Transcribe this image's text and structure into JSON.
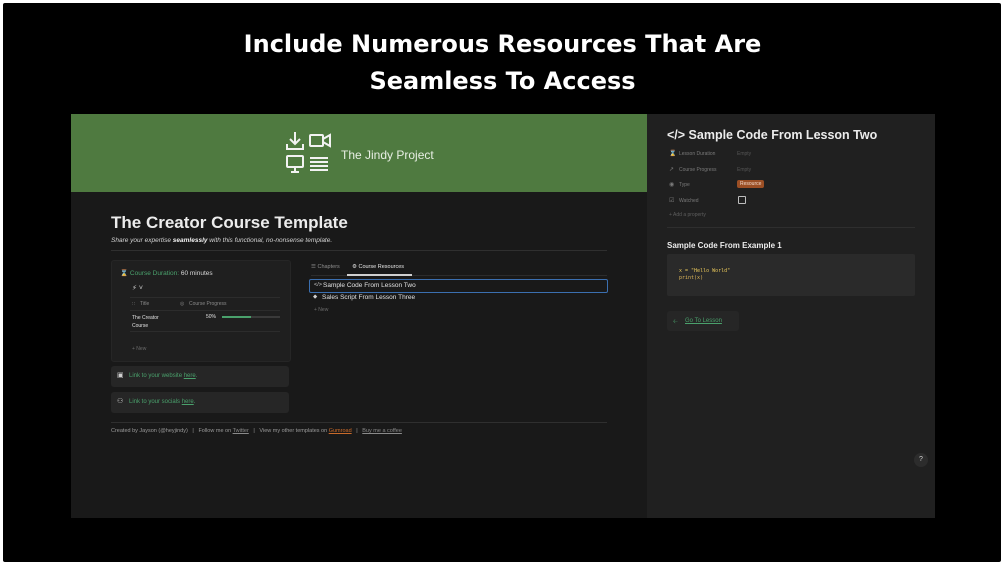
{
  "headline": {
    "line1": "Include Numerous Resources That Are",
    "line2": "Seamless To Access"
  },
  "page": {
    "cover_title": "The Jindy Project",
    "title": "The Creator Course Template",
    "subtitle_pre": "Share your expertise ",
    "subtitle_bold": "seamlessly",
    "subtitle_post": " with this functional, no-nonsense template.",
    "duration_label": "Course Duration:",
    "duration_value": "60 minutes",
    "bolt": "⚡ ˅",
    "table": {
      "headers": [
        "Title",
        "Course Progress"
      ],
      "rows": [
        {
          "title": "The Creator Course",
          "progress_text": "50%",
          "progress": 0.5
        }
      ],
      "new_label": "+ New"
    },
    "links": [
      {
        "icon": "browser-icon",
        "text_pre": "Link to your website ",
        "text_link": "here",
        "text_post": "."
      },
      {
        "icon": "person-add-icon",
        "text_pre": "Link to your socials ",
        "text_link": "here",
        "text_post": "."
      }
    ],
    "tabs": [
      {
        "label": "Chapters",
        "icon": "list-icon"
      },
      {
        "label": "Course Resources",
        "icon": "gear-icon"
      }
    ],
    "resources": [
      {
        "label": "Sample Code From Lesson Two",
        "icon": "code-icon"
      },
      {
        "label": "Sales Script From Lesson Three",
        "icon": "tag-icon"
      }
    ],
    "resources_new": "+ New",
    "footer": {
      "created": "Created by Jayson (@heyjindy)",
      "sep": "|",
      "follow": "Follow me on ",
      "twitter": "Twitter",
      "other": "View my other templates on ",
      "gumroad": "Gumroad",
      "coffee": "Buy me a coffee"
    }
  },
  "peek": {
    "title": "</> Sample Code From Lesson Two",
    "properties": [
      {
        "icon": "hourglass-icon",
        "name": "Lesson Duration",
        "value": "Empty"
      },
      {
        "icon": "arrow-icon",
        "name": "Course Progress",
        "value": "Empty"
      },
      {
        "icon": "type-icon",
        "name": "Type",
        "value": "Resource"
      },
      {
        "icon": "checkbox-icon",
        "name": "Watched",
        "value": ""
      }
    ],
    "add_property": "+ Add a property",
    "subheading": "Sample Code From Example 1",
    "code_line1": "x = \"Hello World\"",
    "code_line2": "print(x)",
    "go_to_lesson": "Go To Lesson",
    "help": "?"
  },
  "colors": {
    "cover": "#4f7a40",
    "accent": "#4aa16c",
    "badge": "#9c4f25",
    "background": "#191919"
  }
}
